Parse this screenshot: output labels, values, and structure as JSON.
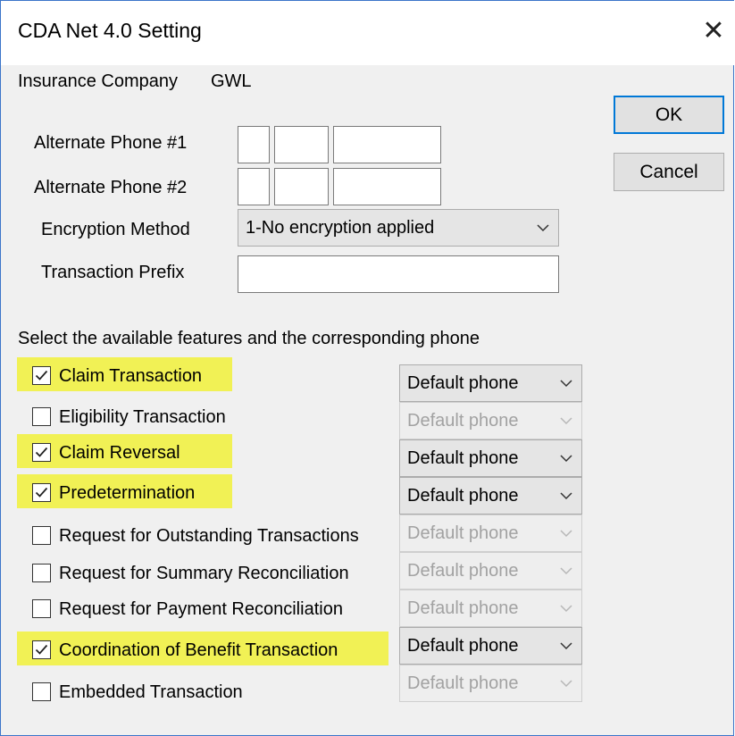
{
  "window": {
    "title": "CDA Net 4.0 Setting",
    "close_glyph": "✕"
  },
  "insurance": {
    "label": "Insurance Company",
    "value": "GWL"
  },
  "buttons": {
    "ok": "OK",
    "cancel": "Cancel"
  },
  "form": {
    "alt_phone_1": {
      "label": "Alternate Phone #1",
      "area": "",
      "prefix": "",
      "number": ""
    },
    "alt_phone_2": {
      "label": "Alternate Phone #2",
      "area": "",
      "prefix": "",
      "number": ""
    },
    "encryption": {
      "label": "Encryption Method",
      "value": "1-No encryption applied"
    },
    "transaction_prefix": {
      "label": "Transaction Prefix",
      "value": ""
    }
  },
  "features_heading": "Select the available features and the corresponding phone",
  "features": [
    {
      "label": "Claim Transaction",
      "checked": true,
      "highlighted": true,
      "phone": "Default phone",
      "enabled": true
    },
    {
      "label": "Eligibility Transaction",
      "checked": false,
      "highlighted": false,
      "phone": "Default phone",
      "enabled": false
    },
    {
      "label": "Claim Reversal",
      "checked": true,
      "highlighted": true,
      "phone": "Default phone",
      "enabled": true
    },
    {
      "label": "Predetermination",
      "checked": true,
      "highlighted": true,
      "phone": "Default phone",
      "enabled": true
    },
    {
      "label": "Request for Outstanding Transactions",
      "checked": false,
      "highlighted": false,
      "phone": "Default phone",
      "enabled": false
    },
    {
      "label": "Request for Summary Reconciliation",
      "checked": false,
      "highlighted": false,
      "phone": "Default phone",
      "enabled": false
    },
    {
      "label": "Request for Payment Reconciliation",
      "checked": false,
      "highlighted": false,
      "phone": "Default phone",
      "enabled": false
    },
    {
      "label": "Coordination of Benefit Transaction",
      "checked": true,
      "highlighted": true,
      "phone": "Default phone",
      "enabled": true
    },
    {
      "label": "Embedded Transaction",
      "checked": false,
      "highlighted": false,
      "phone": "Default phone",
      "enabled": false
    }
  ],
  "colors": {
    "highlight": "#f1f155",
    "window_border": "#3c75c9",
    "default_button_border": "#0078d7"
  },
  "icons": {
    "close": "close-icon",
    "dropdown": "chevron-down-icon",
    "check": "checkmark-icon"
  }
}
